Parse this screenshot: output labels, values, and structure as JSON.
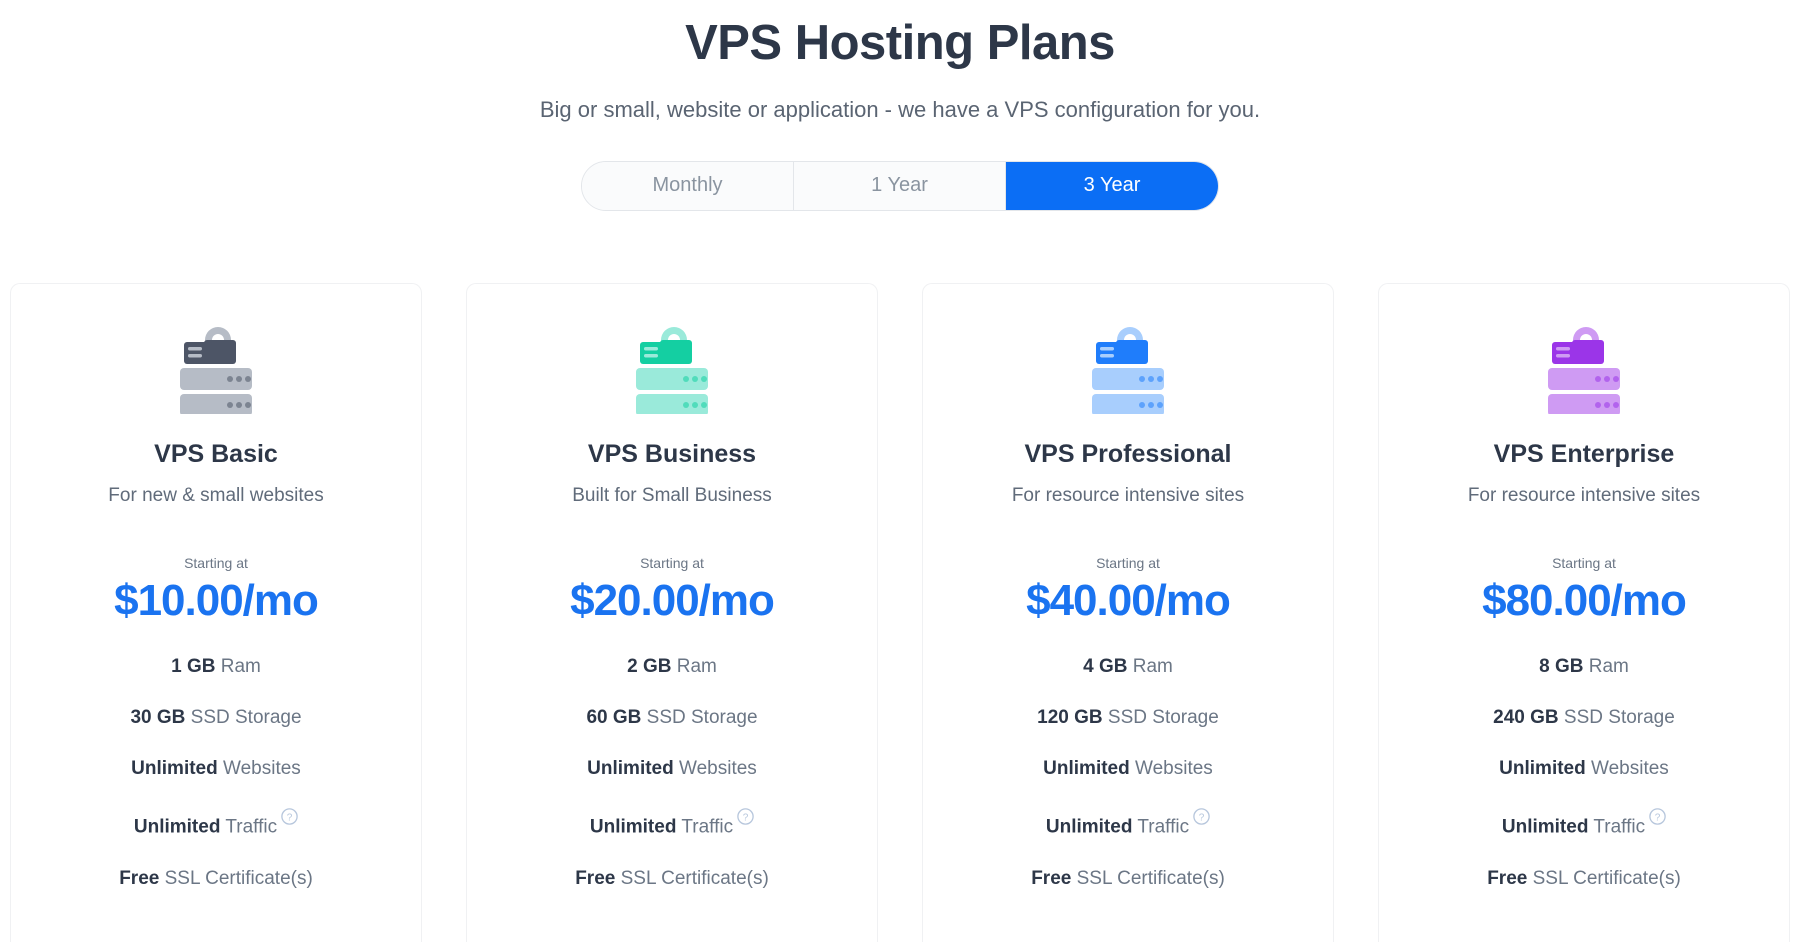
{
  "header": {
    "title": "VPS Hosting Plans",
    "subtitle": "Big or small, website or application - we have a VPS configuration for you."
  },
  "billing_toggle": {
    "options": [
      {
        "label": "Monthly",
        "active": false
      },
      {
        "label": "1 Year",
        "active": false
      },
      {
        "label": "3 Year",
        "active": true
      }
    ],
    "active_label": "3 Year",
    "active_color": "#0b6ef5"
  },
  "common": {
    "starting_at_label": "Starting at",
    "help_icon_glyph": "?"
  },
  "plans": [
    {
      "icon": "server-lock-icon",
      "icon_color_dark": "#4d5566",
      "icon_color_light": "#b6bcc6",
      "name": "VPS Basic",
      "tagline": "For new & small websites",
      "starting_at": "Starting at",
      "price": "$10.00/mo",
      "features": [
        {
          "strong": "1 GB",
          "text": "Ram",
          "help": false
        },
        {
          "strong": "30 GB",
          "text": "SSD Storage",
          "help": false
        },
        {
          "strong": "Unlimited",
          "text": "Websites",
          "help": false
        },
        {
          "strong": "Unlimited",
          "text": "Traffic",
          "help": true
        },
        {
          "strong": "Free",
          "text": "SSL Certificate(s)",
          "help": false
        }
      ]
    },
    {
      "icon": "server-lock-icon",
      "icon_color_dark": "#14cfa2",
      "icon_color_light": "#9aeada",
      "name": "VPS Business",
      "tagline": "Built for Small Business",
      "starting_at": "Starting at",
      "price": "$20.00/mo",
      "features": [
        {
          "strong": "2 GB",
          "text": "Ram",
          "help": false
        },
        {
          "strong": "60 GB",
          "text": "SSD Storage",
          "help": false
        },
        {
          "strong": "Unlimited",
          "text": "Websites",
          "help": false
        },
        {
          "strong": "Unlimited",
          "text": "Traffic",
          "help": true
        },
        {
          "strong": "Free",
          "text": "SSL Certificate(s)",
          "help": false
        }
      ]
    },
    {
      "icon": "server-lock-icon",
      "icon_color_dark": "#1f7dfb",
      "icon_color_light": "#a8cefd",
      "name": "VPS Professional",
      "tagline": "For resource intensive sites",
      "starting_at": "Starting at",
      "price": "$40.00/mo",
      "features": [
        {
          "strong": "4 GB",
          "text": "Ram",
          "help": false
        },
        {
          "strong": "120 GB",
          "text": "SSD Storage",
          "help": false
        },
        {
          "strong": "Unlimited",
          "text": "Websites",
          "help": false
        },
        {
          "strong": "Unlimited",
          "text": "Traffic",
          "help": true
        },
        {
          "strong": "Free",
          "text": "SSL Certificate(s)",
          "help": false
        }
      ]
    },
    {
      "icon": "server-lock-icon",
      "icon_color_dark": "#9b35e8",
      "icon_color_light": "#cf9bf3",
      "name": "VPS Enterprise",
      "tagline": "For resource intensive sites",
      "starting_at": "Starting at",
      "price": "$80.00/mo",
      "features": [
        {
          "strong": "8 GB",
          "text": "Ram",
          "help": false
        },
        {
          "strong": "240 GB",
          "text": "SSD Storage",
          "help": false
        },
        {
          "strong": "Unlimited",
          "text": "Websites",
          "help": false
        },
        {
          "strong": "Unlimited",
          "text": "Traffic",
          "help": true
        },
        {
          "strong": "Free",
          "text": "SSL Certificate(s)",
          "help": false
        }
      ]
    }
  ]
}
